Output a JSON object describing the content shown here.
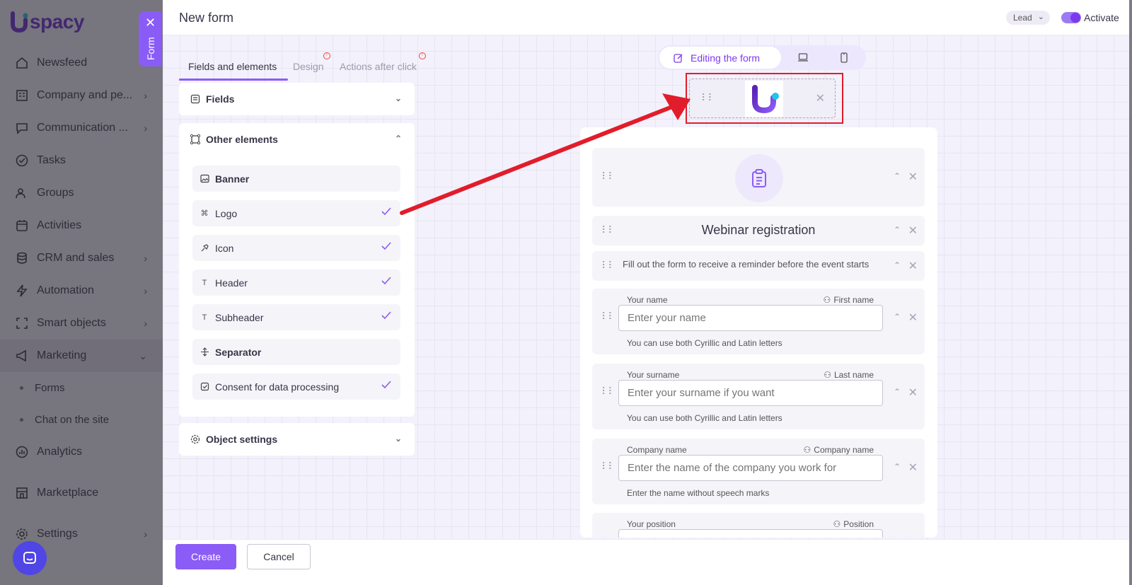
{
  "app": {
    "logo_text": "spacy"
  },
  "sidebar": {
    "items": [
      {
        "label": "Newsfeed",
        "icon": "home-icon",
        "chevron": false
      },
      {
        "label": "Company and pe...",
        "icon": "building-icon",
        "chevron": true
      },
      {
        "label": "Communication ...",
        "icon": "chat-icon",
        "chevron": true
      },
      {
        "label": "Tasks",
        "icon": "check-circle-icon",
        "chevron": false
      },
      {
        "label": "Groups",
        "icon": "users-icon",
        "chevron": false
      },
      {
        "label": "Activities",
        "icon": "calendar-icon",
        "chevron": false
      },
      {
        "label": "CRM and sales",
        "icon": "database-icon",
        "chevron": true
      },
      {
        "label": "Automation",
        "icon": "lightning-icon",
        "chevron": true
      },
      {
        "label": "Smart objects",
        "icon": "scan-icon",
        "chevron": true
      },
      {
        "label": "Marketing",
        "icon": "megaphone-icon",
        "chevron": "down"
      }
    ],
    "sub_items": [
      "Forms",
      "Chat on the site"
    ],
    "items_after": [
      {
        "label": "Analytics",
        "icon": "chart-icon",
        "chevron": false
      },
      {
        "label": "Marketplace",
        "icon": "store-icon",
        "chevron": false
      },
      {
        "label": "Settings",
        "icon": "gear-icon",
        "chevron": true
      }
    ],
    "form_tab_label": "Form"
  },
  "topbar": {
    "title": "New form",
    "entity_select": "Lead",
    "activate_label": "Activate"
  },
  "editor_tabs": [
    {
      "label": "Fields and elements",
      "active": true
    },
    {
      "label": "Design",
      "active": false
    },
    {
      "label": "Actions after click",
      "active": false
    }
  ],
  "panels": {
    "fields": "Fields",
    "other_elements": "Other elements",
    "object_settings": "Object settings",
    "elements": [
      {
        "label": "Banner",
        "checked": false,
        "icon": "image-icon"
      },
      {
        "label": "Logo",
        "checked": true,
        "icon": "command-icon"
      },
      {
        "label": "Icon",
        "checked": true,
        "icon": "pin-icon"
      },
      {
        "label": "Header",
        "checked": true,
        "icon": "text-icon"
      },
      {
        "label": "Subheader",
        "checked": true,
        "icon": "text-icon"
      },
      {
        "label": "Separator",
        "checked": false,
        "icon": "separator-icon"
      },
      {
        "label": "Consent for data processing",
        "checked": true,
        "icon": "checkbox-icon"
      }
    ]
  },
  "preview": {
    "mode_label": "Editing the form"
  },
  "form": {
    "header": "Webinar registration",
    "subheader": "Fill out the form to receive a reminder before the event starts",
    "fields": [
      {
        "label": "Your name",
        "mapped": "First name",
        "placeholder": "Enter your name",
        "help": "You can use both Cyrillic and Latin letters"
      },
      {
        "label": "Your surname",
        "mapped": "Last name",
        "placeholder": "Enter your surname if you want",
        "help": "You can use both Cyrillic and Latin letters"
      },
      {
        "label": "Company name",
        "mapped": "Company name",
        "placeholder": "Enter the name of the company you work for",
        "help": "Enter the name without speech marks"
      },
      {
        "label": "Your position",
        "mapped": "Position",
        "placeholder": "",
        "help": ""
      }
    ]
  },
  "footer": {
    "create": "Create",
    "cancel": "Cancel"
  },
  "colors": {
    "accent": "#8b5cf6",
    "annotation": "#e11d2b",
    "brand": "#6c2bd9"
  }
}
